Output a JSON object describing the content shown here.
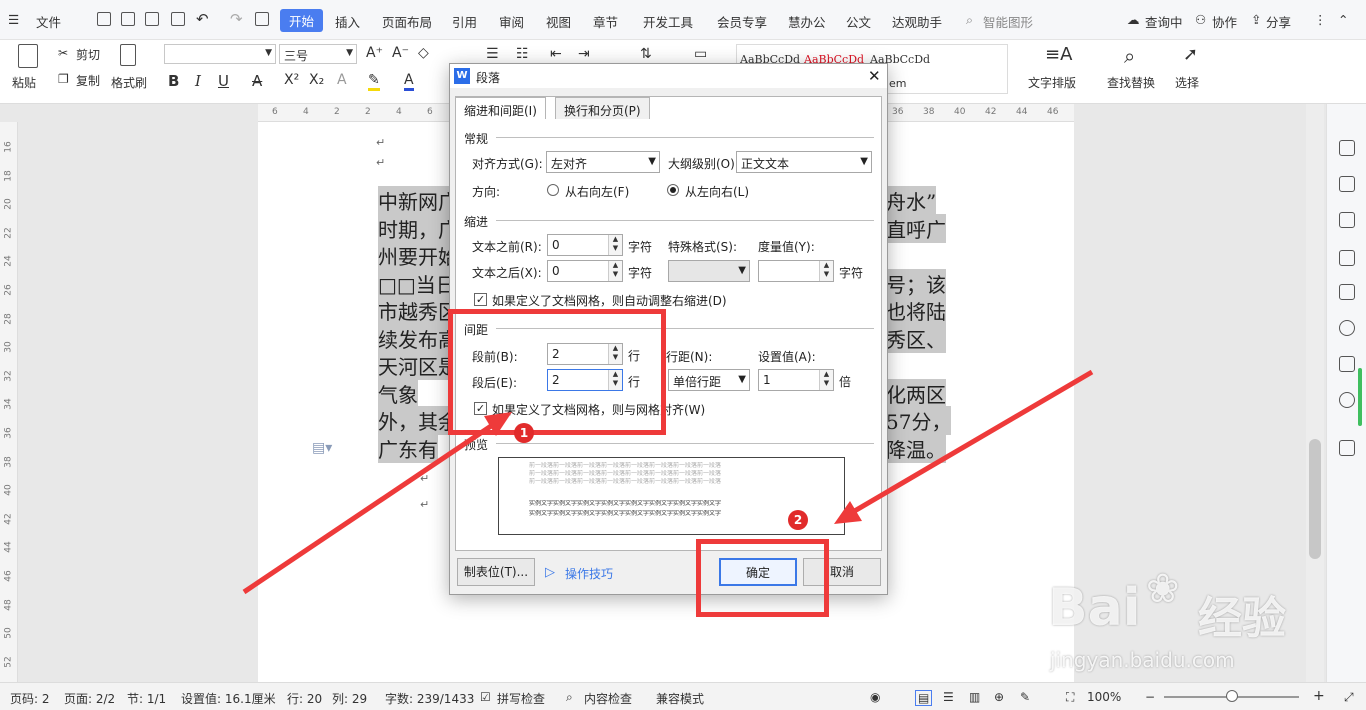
{
  "menubar": {
    "file": "文件",
    "tabs": [
      "开始",
      "插入",
      "页面布局",
      "引用",
      "审阅",
      "视图",
      "章节",
      "开发工具",
      "会员专享",
      "慧办公",
      "公文",
      "达观助手"
    ],
    "search": "智能图形",
    "right": [
      "查询中",
      "协作",
      "分享"
    ]
  },
  "ribbon": {
    "paste": "粘贴",
    "cut": "剪切",
    "copy": "复制",
    "format_painter": "格式刷",
    "font_size": "三号",
    "styles": [
      "AaBbCcDd",
      "AaBbCcDd",
      "AaBbCcDd"
    ],
    "style_partial": "em",
    "text_layout": "文字排版",
    "find_replace": "查找替换",
    "select": "选择"
  },
  "ruler": {
    "top": [
      "6",
      "4",
      "2",
      "2",
      "4",
      "6",
      "8",
      "10",
      "12",
      "14",
      "16",
      "18",
      "20",
      "22",
      "24",
      "26",
      "28",
      "30",
      "32",
      "34",
      "36",
      "38",
      "40",
      "42",
      "44",
      "46"
    ],
    "left": [
      "16",
      "18",
      "20",
      "22",
      "24",
      "26",
      "28",
      "30",
      "32",
      "34",
      "36",
      "38",
      "40",
      "42",
      "44",
      "46",
      "48",
      "50",
      "52"
    ]
  },
  "document": {
    "lines": [
      {
        "left": "中新网广",
        "right": "舟水”"
      },
      {
        "left": "时期，广",
        "right": "直呼广"
      },
      {
        "left": "州要开始",
        "right": ""
      },
      {
        "left": "□□当日",
        "right": "号；该"
      },
      {
        "left": "市越秀区",
        "right": "也将陆"
      },
      {
        "left": "续发布高",
        "right": "秀区、"
      },
      {
        "left": "天河区是",
        "right": ""
      },
      {
        "left": "    气象",
        "right": "化两区"
      },
      {
        "left": "外，其余",
        "right": "57分，"
      },
      {
        "left": "广东有",
        "right": "降温。"
      }
    ]
  },
  "dialog": {
    "title": "段落",
    "tabs": [
      "缩进和间距(I)",
      "换行和分页(P)"
    ],
    "general": {
      "section": "常规",
      "align_label": "对齐方式(G):",
      "align_value": "左对齐",
      "outline_label": "大纲级别(O):",
      "outline_value": "正文文本",
      "direction_label": "方向:",
      "rtl": "从右向左(F)",
      "ltr": "从左向右(L)"
    },
    "indent": {
      "section": "缩进",
      "before_label": "文本之前(R):",
      "before_value": "0",
      "unit1": "字符",
      "special_label": "特殊格式(S):",
      "measure_label": "度量值(Y):",
      "after_label": "文本之后(X):",
      "after_value": "0",
      "unit2": "字符",
      "unit3": "字符",
      "auto_adjust": "如果定义了文档网格，则自动调整右缩进(D)"
    },
    "spacing": {
      "section": "间距",
      "before_label": "段前(B):",
      "before_value": "2",
      "unit_before": "行",
      "line_label": "行距(N):",
      "setting_label": "设置值(A):",
      "after_label": "段后(E):",
      "after_value": "2",
      "unit_after": "行",
      "line_value": "单倍行距",
      "setting_value": "1",
      "setting_unit": "倍",
      "grid_align": "如果定义了文档网格，则与网格对齐(W)"
    },
    "preview": {
      "section": "预览",
      "prev_text": "前一段落前一段落前一段落前一段落前一段落前一段落前一段落前一段落",
      "sample_text": "实例文字实例文字实例文字实例文字实例文字实例文字实例文字实例文字"
    },
    "tabs_btn": "制表位(T)...",
    "tips": "操作技巧",
    "ok": "确定",
    "cancel": "取消"
  },
  "annotations": [
    "1",
    "2"
  ],
  "watermark": {
    "brand": "Bai",
    "brand_cn": "经验",
    "url": "jingyan.baidu.com"
  },
  "statusbar": {
    "items": [
      "页码: 2",
      "页面: 2/2",
      "节: 1/1",
      "设置值: 16.1厘米",
      "行: 20",
      "列: 29",
      "字数: 239/1433",
      "拼写检查",
      "内容检查",
      "兼容模式"
    ],
    "zoom": "100%"
  },
  "colors": {
    "accent": "#4a7df0",
    "annotation": "#ee3a3a"
  }
}
